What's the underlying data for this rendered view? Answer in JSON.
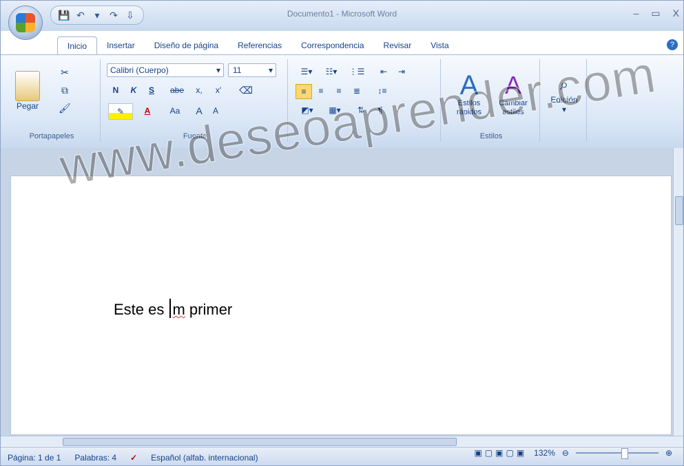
{
  "window": {
    "title": "Documento1 - Microsoft Word",
    "minimize": "–",
    "maximize": "▭",
    "close": "X"
  },
  "tabs": [
    "Inicio",
    "Insertar",
    "Diseño de página",
    "Referencias",
    "Correspondencia",
    "Revisar",
    "Vista"
  ],
  "ribbon": {
    "clipboard": {
      "paste": "Pegar",
      "label": "Portapapeles"
    },
    "font": {
      "family": "Calibri (Cuerpo)",
      "size": "11",
      "bold": "N",
      "italic": "K",
      "underline": "S",
      "strike": "abe",
      "subscript": "x,",
      "superscript": "x'",
      "grow": "A",
      "shrink": "A",
      "change_case": "Aa",
      "label": "Fuente"
    },
    "paragraph": {
      "label": ""
    },
    "styles": {
      "quick": "Estilos rápidos",
      "change": "Cambiar estilos",
      "label": "Estilos"
    },
    "editing": {
      "label": "Edición"
    }
  },
  "document": {
    "before": "Este es ",
    "word": "m",
    "after": " primer"
  },
  "status": {
    "page": "Página: 1 de 1",
    "words": "Palabras: 4",
    "language": "Español (alfab. internacional)",
    "zoom": "132%"
  },
  "watermark": "www.deseoaprender.com"
}
